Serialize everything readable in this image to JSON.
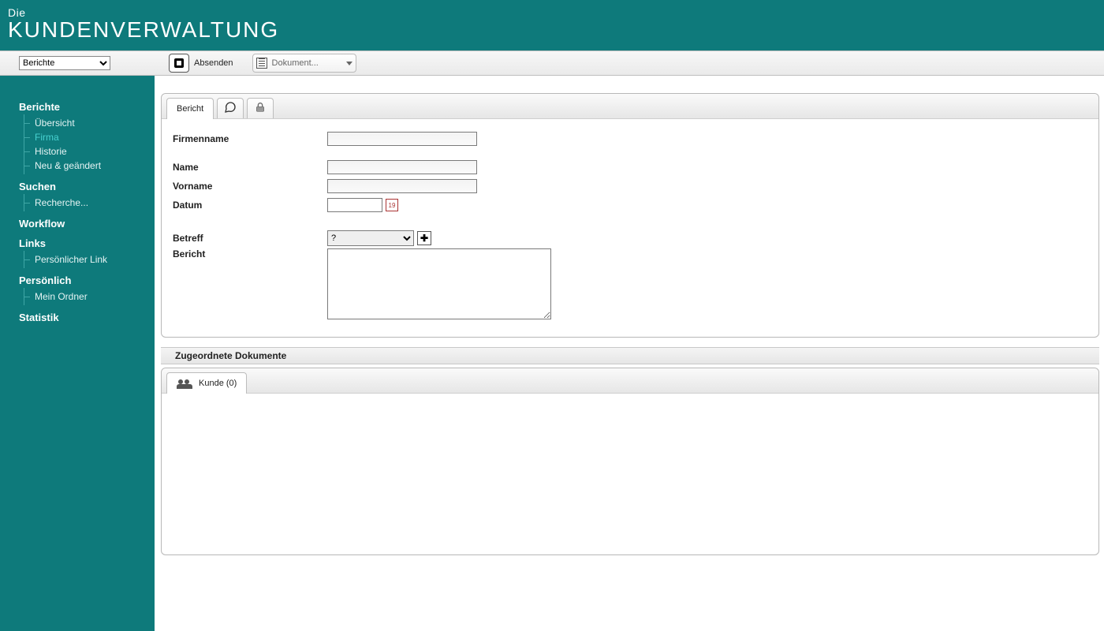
{
  "header": {
    "line1": "Die",
    "line2": "KUNDENVERWALTUNG"
  },
  "toolbar": {
    "top_select_value": "Berichte",
    "absenden_label": "Absenden",
    "dokument_label": "Dokument..."
  },
  "sidebar": {
    "sections": [
      {
        "title": "Berichte",
        "items": [
          "Übersicht",
          "Firma",
          "Historie",
          "Neu & geändert"
        ],
        "active_index": 1
      },
      {
        "title": "Suchen",
        "items": [
          "Recherche..."
        ]
      },
      {
        "title": "Workflow",
        "items": []
      },
      {
        "title": "Links",
        "items": [
          "Persönlicher Link"
        ]
      },
      {
        "title": "Persönlich",
        "items": [
          "Mein Ordner"
        ]
      },
      {
        "title": "Statistik",
        "items": []
      }
    ]
  },
  "form": {
    "tab_bericht": "Bericht",
    "labels": {
      "firmenname": "Firmenname",
      "name": "Name",
      "vorname": "Vorname",
      "datum": "Datum",
      "betreff": "Betreff",
      "bericht": "Bericht"
    },
    "betreff_value": "?",
    "values": {
      "firmenname": "",
      "name": "",
      "vorname": "",
      "datum": "",
      "bericht": ""
    }
  },
  "subsection": {
    "title": "Zugeordnete Dokumente",
    "kunde_tab": "Kunde (0)"
  }
}
